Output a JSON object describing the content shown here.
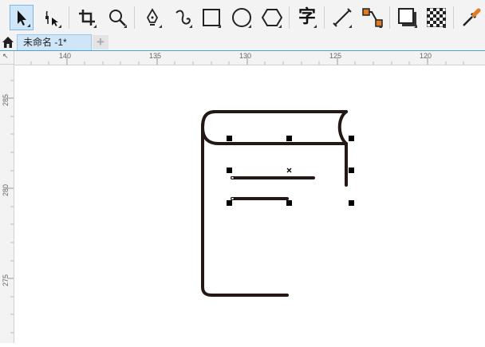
{
  "toolbar": {
    "tools": [
      {
        "name": "pick-tool",
        "icon": "arrow-pointer-icon",
        "active": true
      },
      {
        "name": "shape-tool",
        "icon": "node-edit-icon"
      },
      {
        "name": "crop-tool",
        "icon": "crop-icon"
      },
      {
        "name": "zoom-tool",
        "icon": "magnifier-icon"
      },
      {
        "name": "pen-tool",
        "icon": "pen-nib-icon"
      },
      {
        "name": "artistic-media-tool",
        "icon": "curve-icon"
      },
      {
        "name": "rectangle-tool",
        "icon": "rectangle-icon"
      },
      {
        "name": "ellipse-tool",
        "icon": "ellipse-icon"
      },
      {
        "name": "polygon-tool",
        "icon": "hexagon-icon"
      },
      {
        "name": "text-tool",
        "icon": "text-glyph-icon",
        "glyph": "字"
      },
      {
        "name": "dimension-tool",
        "icon": "parallel-dimension-icon"
      },
      {
        "name": "connector-tool",
        "icon": "connector-icon"
      },
      {
        "name": "drop-shadow-tool",
        "icon": "drop-shadow-icon"
      },
      {
        "name": "transparency-tool",
        "icon": "checkerboard-icon"
      },
      {
        "name": "eyedropper-tool",
        "icon": "eyedropper-icon"
      }
    ]
  },
  "tabs": {
    "document_title": "未命名 -1*",
    "new_tab_label": "+"
  },
  "ruler": {
    "corner_label": "↖",
    "horizontal_ticks": [
      "140",
      "135",
      "130",
      "125",
      "120"
    ],
    "vertical_ticks": [
      "285",
      "280",
      "275"
    ]
  },
  "colors": {
    "accent": "#4aa3df",
    "active_tool_bg": "#cfe6f8",
    "stroke": "#231815",
    "connector_orange": "#e07b22"
  }
}
